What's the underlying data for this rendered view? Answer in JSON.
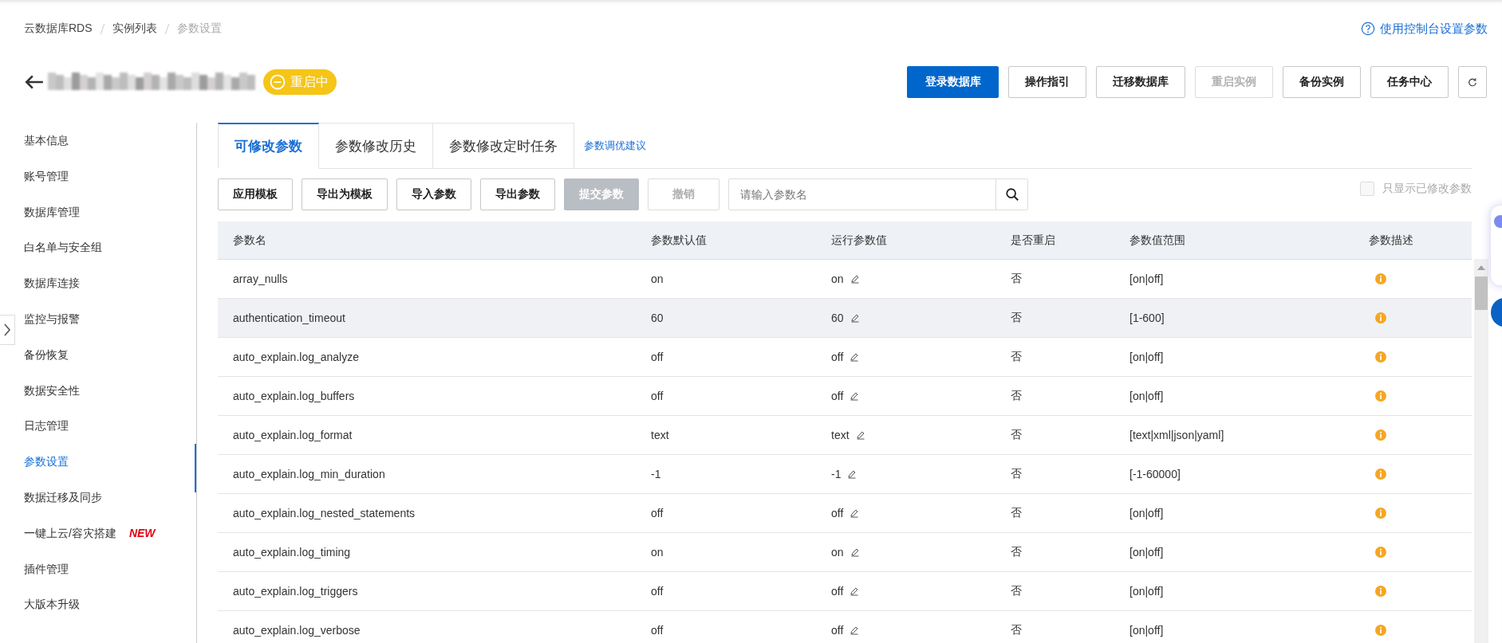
{
  "breadcrumb": [
    {
      "label": "云数据库RDS",
      "current": false
    },
    {
      "label": "实例列表",
      "current": false
    },
    {
      "label": "参数设置",
      "current": true
    }
  ],
  "help_link": "使用控制台设置参数",
  "instance": {
    "status": "重启中"
  },
  "actions": [
    {
      "label": "登录数据库",
      "kind": "primary",
      "disabled": false
    },
    {
      "label": "操作指引",
      "kind": "default",
      "disabled": false
    },
    {
      "label": "迁移数据库",
      "kind": "default",
      "disabled": false
    },
    {
      "label": "重启实例",
      "kind": "default",
      "disabled": true
    },
    {
      "label": "备份实例",
      "kind": "default",
      "disabled": false
    },
    {
      "label": "任务中心",
      "kind": "default",
      "disabled": false
    },
    {
      "kind": "refresh",
      "disabled": false
    }
  ],
  "sidebar": {
    "items": [
      {
        "label": "基本信息",
        "selected": false
      },
      {
        "label": "账号管理",
        "selected": false
      },
      {
        "label": "数据库管理",
        "selected": false
      },
      {
        "label": "白名单与安全组",
        "selected": false
      },
      {
        "label": "数据库连接",
        "selected": false
      },
      {
        "label": "监控与报警",
        "selected": false
      },
      {
        "label": "备份恢复",
        "selected": false
      },
      {
        "label": "数据安全性",
        "selected": false
      },
      {
        "label": "日志管理",
        "selected": false
      },
      {
        "label": "参数设置",
        "selected": true
      },
      {
        "label": "数据迁移及同步",
        "selected": false
      },
      {
        "label": "一键上云/容灾搭建",
        "selected": false,
        "badge": "NEW"
      },
      {
        "label": "插件管理",
        "selected": false
      },
      {
        "label": "大版本升级",
        "selected": false
      }
    ]
  },
  "tabs": [
    {
      "label": "可修改参数",
      "selected": true
    },
    {
      "label": "参数修改历史",
      "selected": false
    },
    {
      "label": "参数修改定时任务",
      "selected": false
    }
  ],
  "tab_link": "参数调优建议",
  "toolbar": {
    "buttons": [
      {
        "label": "应用模板",
        "kind": "default",
        "disabled": false
      },
      {
        "label": "导出为模板",
        "kind": "default",
        "disabled": false
      },
      {
        "label": "导入参数",
        "kind": "default",
        "disabled": false
      },
      {
        "label": "导出参数",
        "kind": "default",
        "disabled": false
      },
      {
        "label": "提交参数",
        "kind": "filled",
        "disabled": true
      },
      {
        "label": "撤销",
        "kind": "default",
        "disabled": true
      }
    ],
    "search": {
      "placeholder": "请输入参数名"
    },
    "filter": {
      "label": "只显示已修改参数",
      "checked": false,
      "disabled": true
    }
  },
  "table": {
    "columns": [
      "参数名",
      "参数默认值",
      "运行参数值",
      "是否重启",
      "参数值范围",
      "参数描述"
    ],
    "rows": [
      {
        "name": "array_nulls",
        "default": "on",
        "value": "on",
        "restart": "否",
        "range": "[on|off]",
        "hovered": false
      },
      {
        "name": "authentication_timeout",
        "default": "60",
        "value": "60",
        "restart": "否",
        "range": "[1-600]",
        "hovered": true
      },
      {
        "name": "auto_explain.log_analyze",
        "default": "off",
        "value": "off",
        "restart": "否",
        "range": "[on|off]",
        "hovered": false
      },
      {
        "name": "auto_explain.log_buffers",
        "default": "off",
        "value": "off",
        "restart": "否",
        "range": "[on|off]",
        "hovered": false
      },
      {
        "name": "auto_explain.log_format",
        "default": "text",
        "value": "text",
        "restart": "否",
        "range": "[text|xml|json|yaml]",
        "hovered": false
      },
      {
        "name": "auto_explain.log_min_duration",
        "default": "-1",
        "value": "-1",
        "restart": "否",
        "range": "[-1-60000]",
        "hovered": false
      },
      {
        "name": "auto_explain.log_nested_statements",
        "default": "off",
        "value": "off",
        "restart": "否",
        "range": "[on|off]",
        "hovered": false
      },
      {
        "name": "auto_explain.log_timing",
        "default": "on",
        "value": "on",
        "restart": "否",
        "range": "[on|off]",
        "hovered": false
      },
      {
        "name": "auto_explain.log_triggers",
        "default": "off",
        "value": "off",
        "restart": "否",
        "range": "[on|off]",
        "hovered": false
      },
      {
        "name": "auto_explain.log_verbose",
        "default": "off",
        "value": "off",
        "restart": "否",
        "range": "[on|off]",
        "hovered": false
      }
    ]
  }
}
